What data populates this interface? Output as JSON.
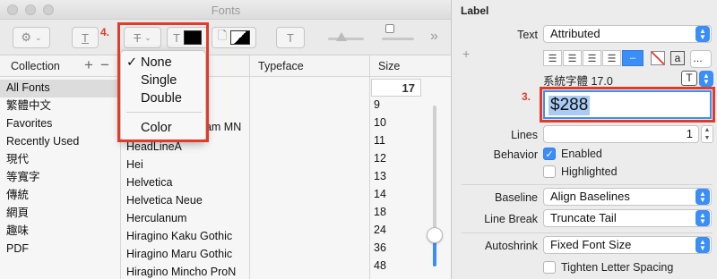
{
  "fonts_window": {
    "title": "Fonts",
    "toolbar": {
      "callout_number": "4.",
      "more_label": "»"
    },
    "headers": {
      "collection": "Collection",
      "add": "+",
      "remove": "−",
      "typeface": "Typeface",
      "size": "Size"
    },
    "collections": [
      "All Fonts",
      "繁體中文",
      "Favorites",
      "Recently Used",
      "現代",
      "等寬字",
      "傳統",
      "網頁",
      "趣味",
      "PDF"
    ],
    "families": [
      "HeadLineA",
      "Hei",
      "Helvetica",
      "Helvetica Neue",
      "Herculanum",
      "Hiragino Kaku Gothic",
      "Hiragino Maru Gothic",
      "Hiragino Mincho ProN"
    ],
    "family_partial": "gam MN",
    "size_value": "17",
    "sizes": [
      "9",
      "10",
      "11",
      "12",
      "13",
      "14",
      "18",
      "24",
      "36",
      "48"
    ],
    "strikethrough_menu": {
      "items": [
        "None",
        "Single",
        "Double",
        "Color"
      ],
      "checked": "None"
    }
  },
  "inspector": {
    "section_title": "Label",
    "text_label": "Text",
    "text_value": "Attributed",
    "font_value": "系統字體 17.0",
    "callout_number": "3.",
    "text_content": "$288",
    "lines_label": "Lines",
    "lines_value": "1",
    "behavior_label": "Behavior",
    "enabled_label": "Enabled",
    "highlighted_label": "Highlighted",
    "baseline_label": "Baseline",
    "baseline_value": "Align Baselines",
    "linebreak_label": "Line Break",
    "linebreak_value": "Truncate Tail",
    "autoshrink_label": "Autoshrink",
    "autoshrink_value": "Fixed Font Size",
    "tighten_label": "Tighten Letter Spacing",
    "add_symbol": "+",
    "more_options": "…"
  },
  "colors": {
    "accent": "#3a8ef6",
    "annotation": "#e23b2a"
  }
}
